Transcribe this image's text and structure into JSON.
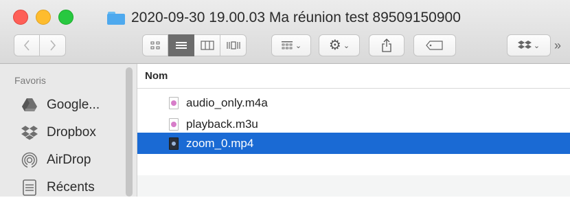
{
  "window": {
    "title": "2020-09-30 19.00.03 Ma réunion test 89509150900"
  },
  "toolbar": {
    "back_icon": "chevron-left-icon",
    "forward_icon": "chevron-right-icon",
    "view_modes": [
      "icon-view",
      "list-view",
      "column-view",
      "gallery-view"
    ],
    "active_view": "list-view",
    "more_label": "»"
  },
  "sidebar": {
    "heading": "Favoris",
    "items": [
      {
        "label": "Google...",
        "icon": "google-drive-icon"
      },
      {
        "label": "Dropbox",
        "icon": "dropbox-icon"
      },
      {
        "label": "AirDrop",
        "icon": "airdrop-icon"
      },
      {
        "label": "Récents",
        "icon": "recents-icon"
      }
    ]
  },
  "list": {
    "column_header": "Nom",
    "files": [
      {
        "name": "audio_only.m4a",
        "icon": "audio-file-icon",
        "selected": false
      },
      {
        "name": "playback.m3u",
        "icon": "playlist-file-icon",
        "selected": false
      },
      {
        "name": "zoom_0.mp4",
        "icon": "video-file-icon",
        "selected": true
      }
    ]
  },
  "colors": {
    "selection": "#1a6ad4",
    "folder": "#4ea9ee",
    "close": "#fe5f57",
    "minimize": "#febc2e",
    "zoom": "#28c840"
  }
}
